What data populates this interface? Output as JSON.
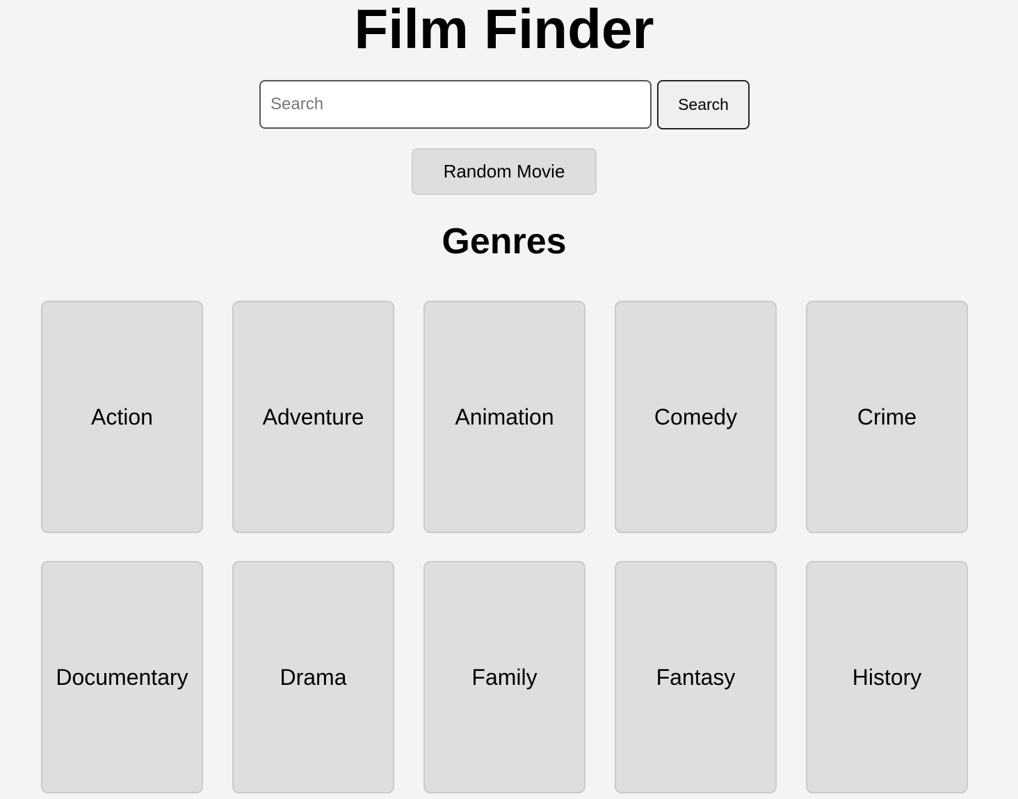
{
  "header": {
    "title": "Film Finder"
  },
  "search": {
    "placeholder": "Search",
    "value": "",
    "button_label": "Search"
  },
  "random": {
    "button_label": "Random Movie"
  },
  "genres": {
    "heading": "Genres",
    "items": [
      "Action",
      "Adventure",
      "Animation",
      "Comedy",
      "Crime",
      "Documentary",
      "Drama",
      "Family",
      "Fantasy",
      "History"
    ]
  },
  "colors": {
    "background": "#f4f4f4",
    "card": "#dedede",
    "card_border": "#cacaca"
  }
}
